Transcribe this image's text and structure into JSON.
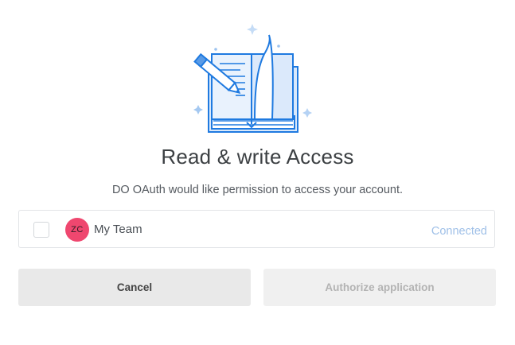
{
  "dialog": {
    "title": "Read & write Access",
    "subtitle": "DO OAuth would like permission to access your account."
  },
  "team": {
    "avatar_initials": "ZC",
    "name": "My Team",
    "status": "Connected",
    "checked": false
  },
  "actions": {
    "cancel_label": "Cancel",
    "authorize_label": "Authorize application"
  },
  "colors": {
    "accent_blue": "#1f7ae0",
    "avatar_red": "#ef476f",
    "connected_text": "#9fc0e8"
  },
  "icons": {
    "illustration": "book-with-pencil-illustration"
  }
}
